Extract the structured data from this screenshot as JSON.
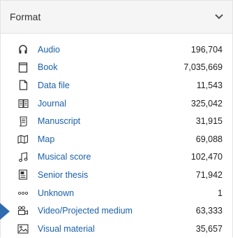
{
  "facet": {
    "title": "Format",
    "toggle_icon": "chevron-down-icon",
    "items": [
      {
        "label": "Audio",
        "count": "196,704",
        "icon": "headphones-icon"
      },
      {
        "label": "Book",
        "count": "7,035,669",
        "icon": "book-icon"
      },
      {
        "label": "Data file",
        "count": "11,543",
        "icon": "file-icon"
      },
      {
        "label": "Journal",
        "count": "325,042",
        "icon": "journal-icon"
      },
      {
        "label": "Manuscript",
        "count": "31,915",
        "icon": "manuscript-icon"
      },
      {
        "label": "Map",
        "count": "69,088",
        "icon": "map-icon"
      },
      {
        "label": "Musical score",
        "count": "102,470",
        "icon": "music-note-icon"
      },
      {
        "label": "Senior thesis",
        "count": "71,942",
        "icon": "thesis-icon"
      },
      {
        "label": "Unknown",
        "count": "1",
        "icon": "ellipsis-icon"
      },
      {
        "label": "Video/Projected medium",
        "count": "63,333",
        "icon": "video-icon"
      },
      {
        "label": "Visual material",
        "count": "35,657",
        "icon": "image-icon"
      }
    ]
  },
  "colors": {
    "link": "#1a60a8",
    "header_bg": "#f5f5f5",
    "pointer": "#2e6bb0"
  }
}
